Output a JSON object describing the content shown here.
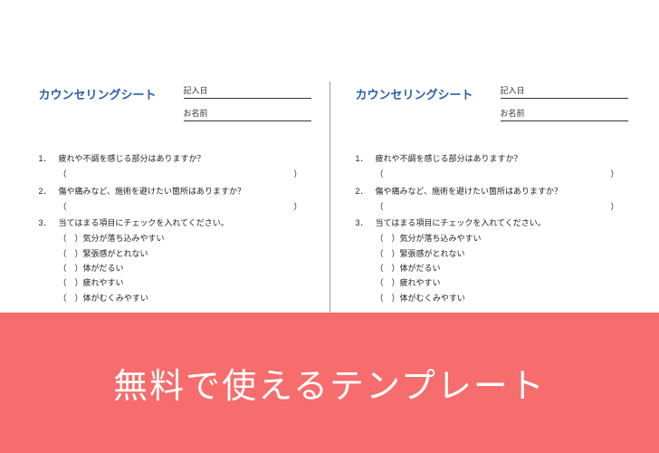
{
  "banner": "無料で使えるテンプレート",
  "doc": {
    "title": "カウンセリングシート",
    "fields": {
      "date_label": "記入日",
      "name_label": "お名前"
    },
    "q1_num": "1．",
    "q1_text": "疲れや不調を感じる部分はありますか？",
    "q2_num": "2．",
    "q2_text": "傷や痛みなど、施術を避けたい箇所はありますか？",
    "q3_num": "3．",
    "q3_text": "当てはまる項目にチェックを入れてください。",
    "paren_open": "（",
    "paren_close": "）",
    "checks": {
      "c1": "（　）気分が落ち込みやすい",
      "c2": "（　）緊張感がとれない",
      "c3": "（　）体がだるい",
      "c4": "（　）疲れやすい",
      "c5": "（　）体がむくみやすい"
    }
  }
}
